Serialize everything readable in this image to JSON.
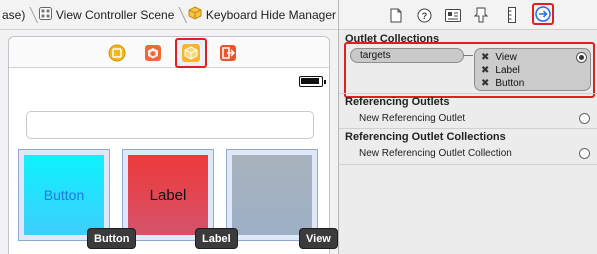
{
  "breadcrumb": {
    "items": [
      {
        "label": "ase)"
      },
      {
        "label": "View Controller Scene"
      },
      {
        "label": "Keyboard Hide Manager"
      }
    ]
  },
  "scene_dock": {
    "icons": [
      "view-controller-icon",
      "first-responder-icon",
      "object-icon",
      "exit-icon"
    ],
    "selected": "object-icon"
  },
  "canvas": {
    "tiles": [
      {
        "label": "Button",
        "color": "#0ef2fd"
      },
      {
        "label": "Label",
        "color": "#ef3a3a"
      },
      {
        "label": "",
        "color": "#a8b2bd"
      }
    ],
    "badges": [
      "Button",
      "Label",
      "View"
    ]
  },
  "inspector": {
    "tabs": [
      "file-icon",
      "help-icon",
      "identity-icon",
      "attributes-icon",
      "size-icon",
      "connections-icon"
    ],
    "selected_tab": "connections-icon",
    "outlet_collections": {
      "title": "Outlet Collections",
      "outlet": "targets",
      "targets": [
        "View",
        "Label",
        "Button"
      ]
    },
    "referencing_outlets": {
      "title": "Referencing Outlets",
      "row": "New Referencing Outlet"
    },
    "referencing_outlet_collections": {
      "title": "Referencing Outlet Collections",
      "row": "New Referencing Outlet Collection"
    }
  },
  "colors": {
    "highlight": "#e02020",
    "accent": "#1e6ff0"
  }
}
